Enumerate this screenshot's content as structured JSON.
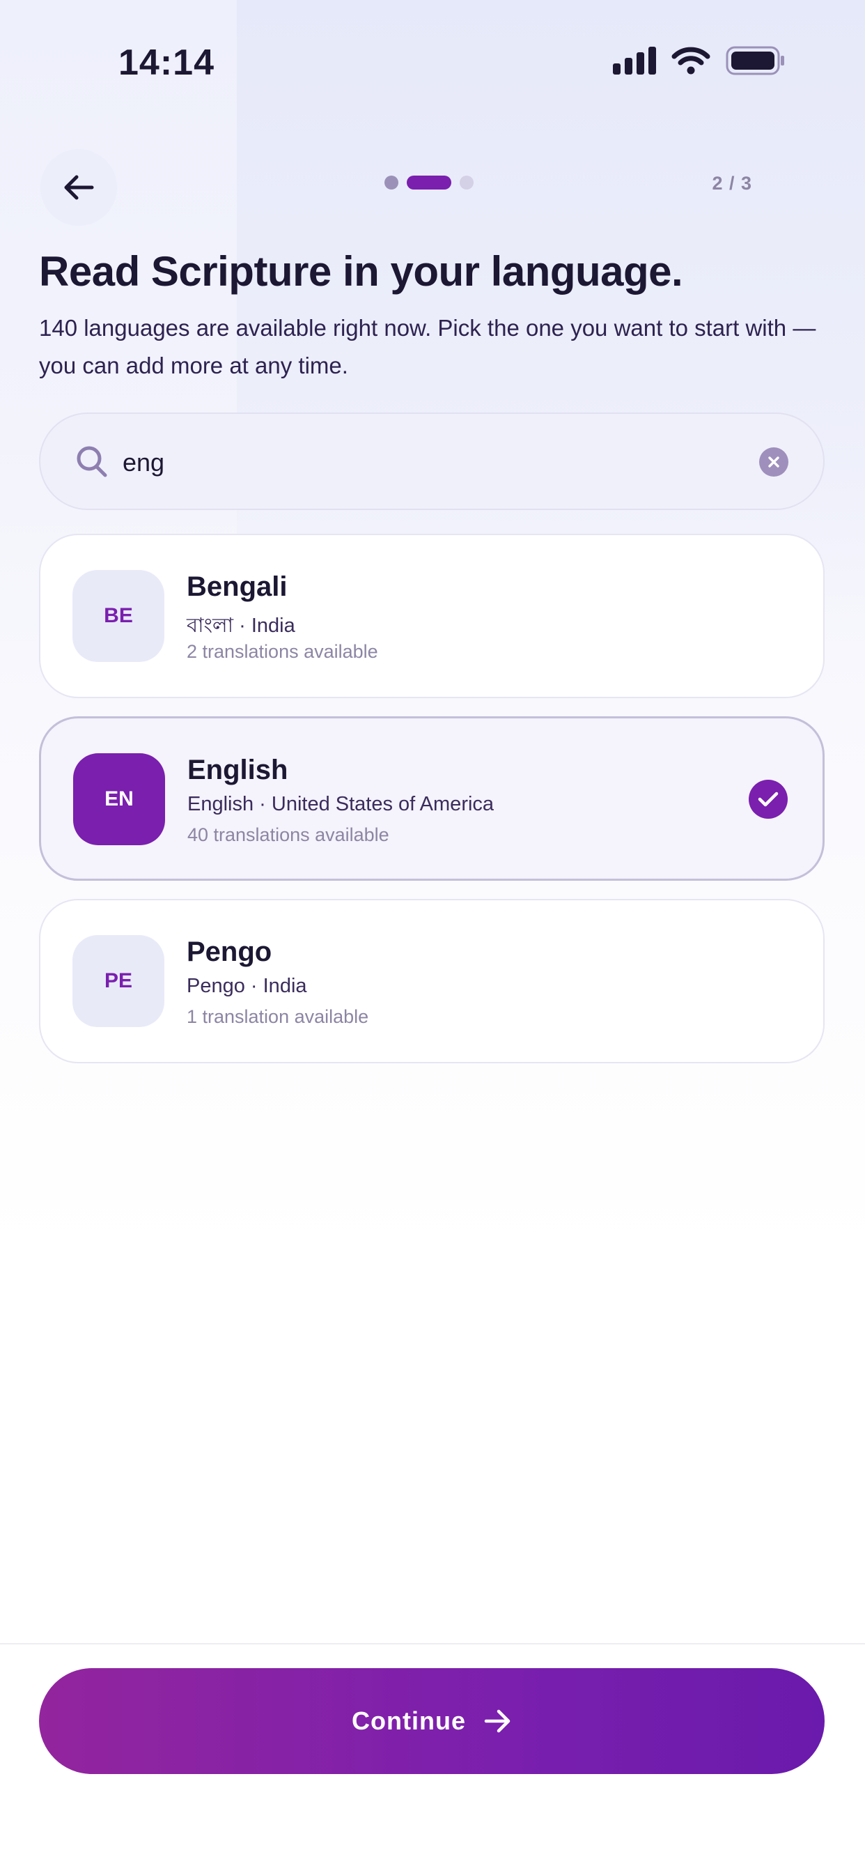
{
  "status_bar": {
    "time": "14:14"
  },
  "header": {
    "step": "2 / 3",
    "steps_total": 3,
    "steps_current": 2
  },
  "title": "Read Scripture in your language.",
  "subtitle": "140 languages are available right now. Pick the one you want to start with — you can add more at any time.",
  "search": {
    "value": "eng"
  },
  "languages": [
    {
      "code": "BE",
      "name": "Bengali",
      "subtitle": "বাংলা · India",
      "count": "2 translations available",
      "selected": false
    },
    {
      "code": "EN",
      "name": "English",
      "subtitle": "English · United States of America",
      "count": "40 translations available",
      "selected": true
    },
    {
      "code": "PE",
      "name": "Pengo",
      "subtitle": "Pengo · India",
      "count": "1 translation available",
      "selected": false
    }
  ],
  "footer": {
    "continue_label": "Continue"
  },
  "colors": {
    "accent": "#7a1fae",
    "accent_start": "#93259e",
    "text": "#1c1733",
    "muted": "#8d85a4"
  },
  "icons": {
    "back": "arrow-left-icon",
    "search": "search-icon",
    "clear": "clear-icon",
    "check": "check-icon",
    "continue": "arrow-right-icon"
  }
}
